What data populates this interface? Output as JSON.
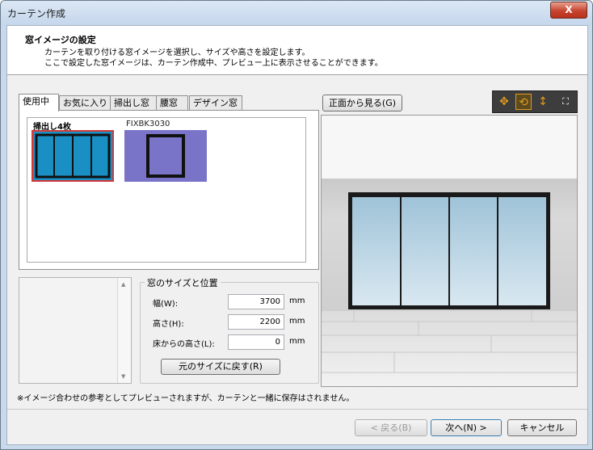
{
  "window": {
    "title": "カーテン作成",
    "close_glyph": "X"
  },
  "header": {
    "title": "窓イメージの設定",
    "line1": "カーテンを取り付ける窓イメージを選択し、サイズや高さを設定します。",
    "line2": "ここで設定した窓イメージは、カーテン作成中、プレビュー上に表示させることができます。"
  },
  "tabs": [
    {
      "label": "使用中",
      "active": true
    },
    {
      "label": "お気に入り",
      "active": false
    },
    {
      "label": "掃出し窓",
      "active": false
    },
    {
      "label": "腰窓",
      "active": false
    },
    {
      "label": "デザイン窓",
      "active": false
    }
  ],
  "thumbnails": [
    {
      "label": "掃出し4枚",
      "selected": true,
      "color": "#1a8fc4"
    },
    {
      "label": "FIXBK3030",
      "selected": false,
      "color": "#7a74c8"
    }
  ],
  "size_group": {
    "title": "窓のサイズと位置",
    "fields": [
      {
        "label": "幅(W):",
        "value": "3700",
        "unit": "mm"
      },
      {
        "label": "高さ(H):",
        "value": "2200",
        "unit": "mm"
      },
      {
        "label": "床からの高さ(L):",
        "value": "0",
        "unit": "mm"
      }
    ],
    "reset_label": "元のサイズに戻す(R)"
  },
  "preview": {
    "front_view_label": "正面から見る(G)",
    "toolbar_icons": [
      "move-icon",
      "rotate-icon",
      "updown-icon",
      "fit-icon"
    ]
  },
  "footnote": "※イメージ合わせの参考としてプレビューされますが、カーテンと一緒に保存はされません。",
  "buttons": {
    "back": "< 戻る(B)",
    "next": "次へ(N) >",
    "cancel": "キャンセル"
  },
  "colors": {
    "accent_selected": "#d43a3a",
    "toolbar_bg": "#3d3d3d",
    "icon_orange": "#e39a1c"
  }
}
